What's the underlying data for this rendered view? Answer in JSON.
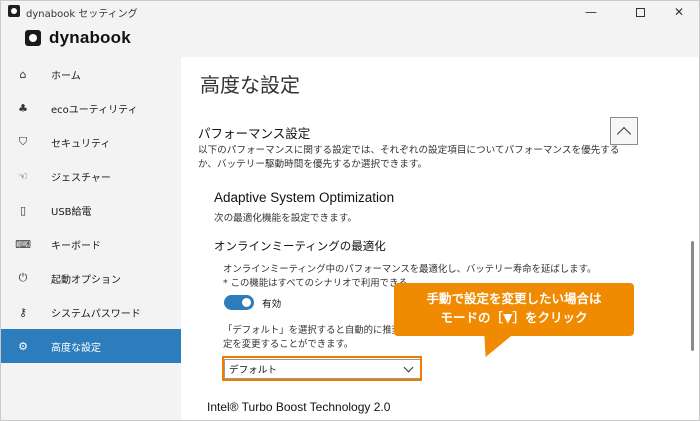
{
  "window": {
    "title": "dynabook セッティング",
    "minimize": "—",
    "close": "✕"
  },
  "logo": {
    "text": "dynabook"
  },
  "sidebar": {
    "items": [
      {
        "label": "ホーム",
        "icon": "home-icon",
        "glyph": "⌂"
      },
      {
        "label": "ecoユーティリティ",
        "icon": "eco-icon",
        "glyph": "♣"
      },
      {
        "label": "セキュリティ",
        "icon": "shield-icon",
        "glyph": "⛉"
      },
      {
        "label": "ジェスチャー",
        "icon": "gesture-icon",
        "glyph": "☜"
      },
      {
        "label": "USB給電",
        "icon": "usb-icon",
        "glyph": "▯"
      },
      {
        "label": "キーボード",
        "icon": "keyboard-icon",
        "glyph": "⌨"
      },
      {
        "label": "起動オプション",
        "icon": "power-icon",
        "glyph": "⏻"
      },
      {
        "label": "システムパスワード",
        "icon": "key-icon",
        "glyph": "⚷"
      },
      {
        "label": "高度な設定",
        "icon": "gear-icon",
        "glyph": "⚙",
        "active": true
      }
    ]
  },
  "main": {
    "page_title": "高度な設定",
    "section_title": "パフォーマンス設定",
    "section_desc": "以下のパフォーマンスに関する設定では、それぞれの設定項目についてパフォーマンスを優先するか、バッテリー駆動時間を優先するか選択できます。",
    "aso_title": "Adaptive System Optimization",
    "aso_desc": "次の最適化機能を設定できます。",
    "omo_title": "オンラインミーティングの最適化",
    "omo_desc_line1": "オンラインミーティング中のパフォーマンスを最適化し、バッテリー寿命を延ばします。",
    "omo_desc_line2": "* この機能はすべてのシナリオで利用できる",
    "toggle_label": "有効",
    "default_desc_line1": "「デフォルト」を選択すると自動的に推奨設",
    "default_desc_line2": "定を変更することができます。",
    "select_value": "デフォルト",
    "intel_title": "Intel® Turbo Boost Technology 2.0"
  },
  "callout": {
    "line1": "手動で設定を変更したい場合は",
    "line2": "モードの［▼］をクリック"
  },
  "colors": {
    "accent": "#2d7dbd",
    "callout": "#f08a00"
  }
}
